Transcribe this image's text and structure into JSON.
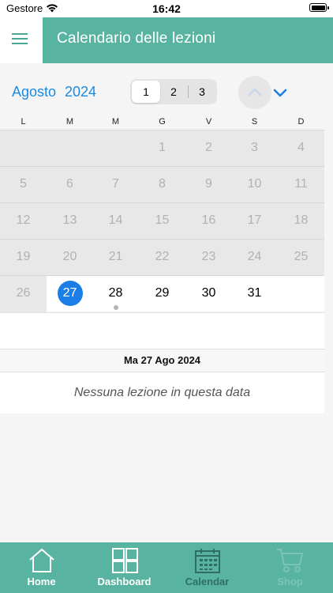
{
  "status": {
    "carrier": "Gestore",
    "time": "16:42"
  },
  "header": {
    "title": "Calendario delle lezioni"
  },
  "calendar": {
    "month": "Agosto",
    "year": "2024",
    "segments": [
      "1",
      "2",
      "3"
    ],
    "selected_segment": "1",
    "weekdays": [
      "L",
      "M",
      "M",
      "G",
      "V",
      "S",
      "D"
    ],
    "weeks": [
      [
        "",
        "",
        "",
        "1",
        "2",
        "3",
        "4"
      ],
      [
        "5",
        "6",
        "7",
        "8",
        "9",
        "10",
        "11"
      ],
      [
        "12",
        "13",
        "14",
        "15",
        "16",
        "17",
        "18"
      ],
      [
        "19",
        "20",
        "21",
        "22",
        "23",
        "24",
        "25"
      ],
      [
        "26",
        "27",
        "28",
        "29",
        "30",
        "31",
        ""
      ]
    ],
    "selected_day": "27",
    "event_day": "28"
  },
  "selected_date_label": "Ma 27 Ago 2024",
  "empty_message": "Nessuna lezione in questa data",
  "tabs": [
    {
      "label": "Home",
      "icon": "home-icon"
    },
    {
      "label": "Dashboard",
      "icon": "dashboard-icon"
    },
    {
      "label": "Calendar",
      "icon": "calendar-icon"
    },
    {
      "label": "Shop",
      "icon": "cart-icon"
    }
  ],
  "colors": {
    "accent": "#59b3a1",
    "selected": "#1a7ee6",
    "link": "#1a8be0"
  }
}
